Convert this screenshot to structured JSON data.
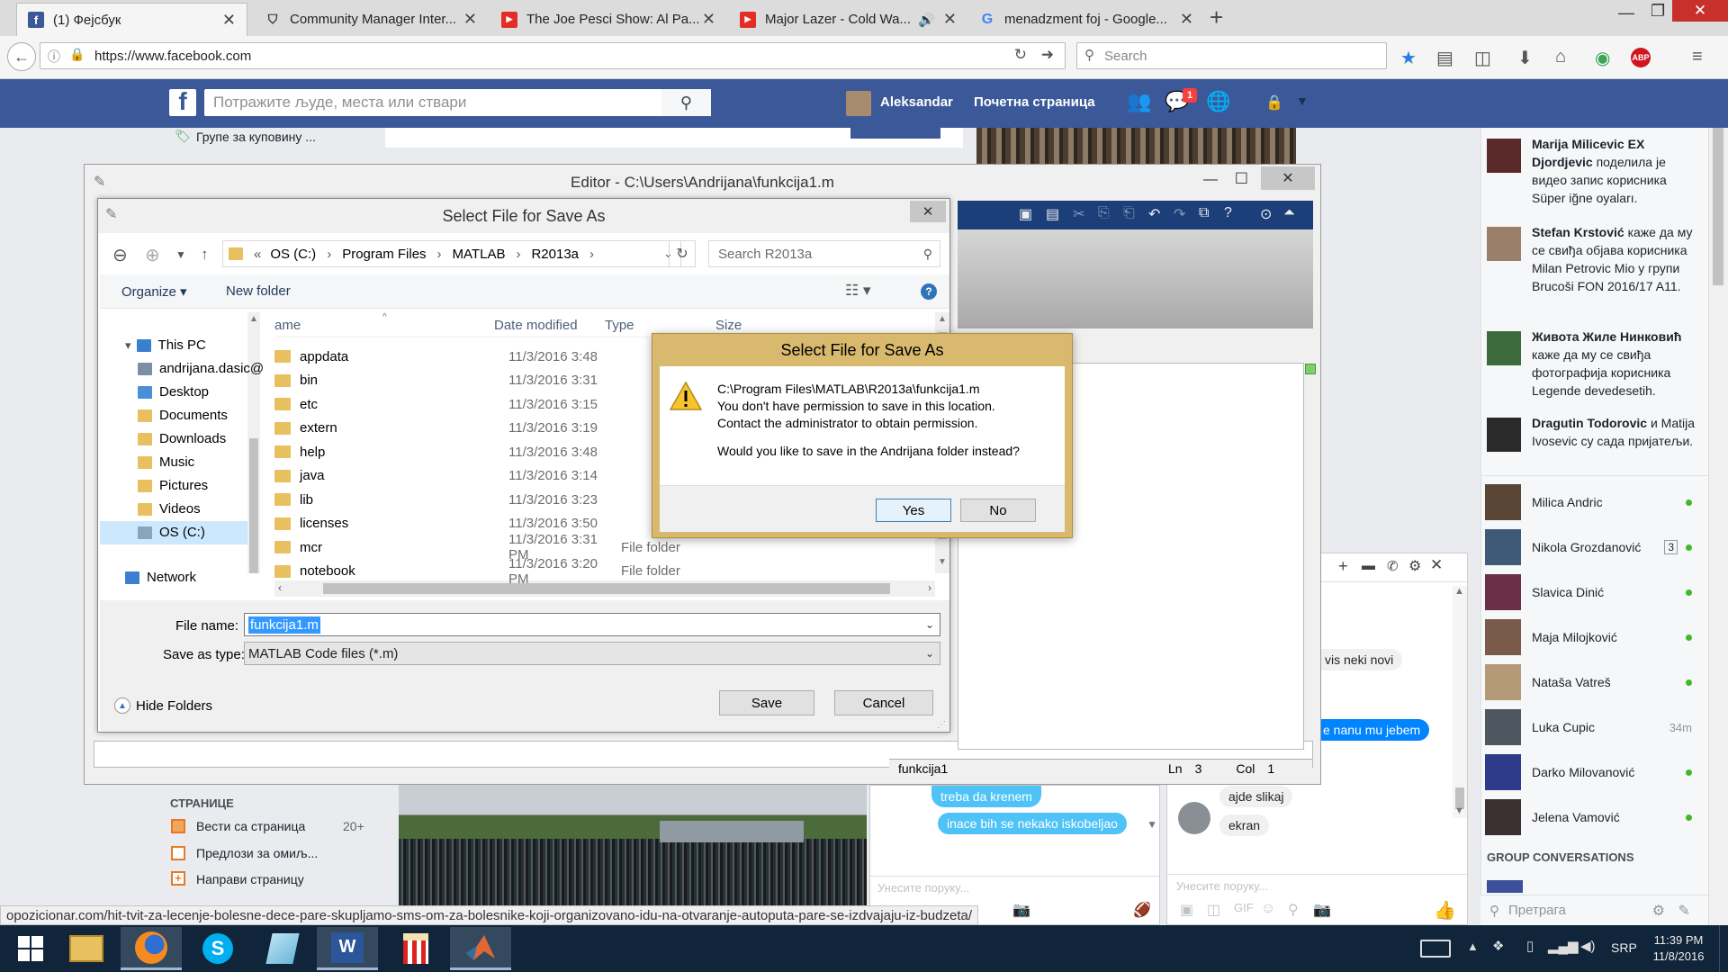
{
  "browser": {
    "tabs": [
      {
        "title": "(1) Фејсбук",
        "icon": "facebook-icon",
        "active": true
      },
      {
        "title": "Community Manager Inter...",
        "icon": "shield-icon"
      },
      {
        "title": "The Joe Pesci Show: Al Pa...",
        "icon": "youtube-icon"
      },
      {
        "title": "Major Lazer - Cold Wa...",
        "icon": "youtube-icon"
      },
      {
        "title": "menadzment foj - Google...",
        "icon": "google-icon"
      }
    ],
    "new_tab": "+",
    "url": "https://www.facebook.com",
    "search_placeholder": "Search"
  },
  "facebook": {
    "search_placeholder": "Потражите људе, места или ствари",
    "user_name": "Aleksandar",
    "home_label": "Почетна страница",
    "notification_count": "1",
    "left_top_item": "Групе за куповину ...",
    "pages_header": "СТРАНИЦЕ",
    "pages_items": [
      {
        "label": "Вести са страница",
        "count": "20+"
      },
      {
        "label": "Предлози за омиљ...",
        "count": ""
      },
      {
        "label": "Направи страницу",
        "count": ""
      }
    ],
    "ticker": [
      {
        "bold": "Marija Milicevic EX Djordjevic",
        "text": " поделила је видео запис корисника Süper iğne oyaları."
      },
      {
        "bold": "Stefan Krstović",
        "text": " каже да му се свиђа објава корисника Milan Petrovic Mio у групи Brucoši FON 2016/17 A11."
      },
      {
        "bold": "Живота Жиле Нинковић",
        "text": " каже да му се свиђа фотографија корисника Legende devedesetih."
      },
      {
        "bold": "Dragutin Todorovic",
        "text": " и Matija Ivosevic су сада пријатељи."
      }
    ],
    "contacts": [
      {
        "name": "Milica Andric",
        "meta": "",
        "online": true
      },
      {
        "name": "Nikola Grozdanović",
        "meta": "3",
        "online": true
      },
      {
        "name": "Slavica Dinić",
        "meta": "",
        "online": true
      },
      {
        "name": "Maja Milojković",
        "meta": "",
        "online": true
      },
      {
        "name": "Nataša Vatreš",
        "meta": "",
        "online": true
      },
      {
        "name": "Luka Cupic",
        "meta": "34m",
        "online": false
      },
      {
        "name": "Darko Milovanović",
        "meta": "",
        "online": true
      },
      {
        "name": "Jelena Vamović",
        "meta": "",
        "online": true
      }
    ],
    "group_conversations": "GROUP CONVERSATIONS",
    "chat_search_placeholder": "Претрага",
    "chat1_messages": [
      "treba da krenem",
      "inace bih se nekako iskobeljao"
    ],
    "chat1_placeholder": "Унесите поруку...",
    "chat2_messages_received": [
      "vis neki novi",
      "ajde slikaj",
      "ekran"
    ],
    "chat2_message_sent": "e nanu mu jebem",
    "chat2_placeholder": "Унесите поруку..."
  },
  "matlab_editor": {
    "title": "Editor - C:\\Users\\Andrijana\\funkcija1.m",
    "status_file": "funkcija1",
    "status_ln_label": "Ln",
    "status_ln": "3",
    "status_col_label": "Col",
    "status_col": "1"
  },
  "save_dialog": {
    "title": "Select File for Save As",
    "breadcrumb": [
      "OS (C:)",
      "Program Files",
      "MATLAB",
      "R2013a"
    ],
    "breadcrumb_prefix": "«",
    "search_placeholder": "Search R2013a",
    "organize_label": "Organize",
    "new_folder_label": "New folder",
    "columns": {
      "name": "ame",
      "date": "Date modified",
      "type": "Type",
      "size": "Size"
    },
    "tree": [
      {
        "label": "This PC",
        "level": 0
      },
      {
        "label": "andrijana.dasic@",
        "level": 1
      },
      {
        "label": "Desktop",
        "level": 1
      },
      {
        "label": "Documents",
        "level": 1
      },
      {
        "label": "Downloads",
        "level": 1
      },
      {
        "label": "Music",
        "level": 1
      },
      {
        "label": "Pictures",
        "level": 1
      },
      {
        "label": "Videos",
        "level": 1
      },
      {
        "label": "OS (C:)",
        "level": 1
      },
      {
        "label": "Network",
        "level": 0
      }
    ],
    "files": [
      {
        "name": "appdata",
        "date": "11/3/2016 3:48",
        "type": ""
      },
      {
        "name": "bin",
        "date": "11/3/2016 3:31",
        "type": ""
      },
      {
        "name": "etc",
        "date": "11/3/2016 3:15",
        "type": ""
      },
      {
        "name": "extern",
        "date": "11/3/2016 3:19",
        "type": ""
      },
      {
        "name": "help",
        "date": "11/3/2016 3:48",
        "type": ""
      },
      {
        "name": "java",
        "date": "11/3/2016 3:14",
        "type": ""
      },
      {
        "name": "lib",
        "date": "11/3/2016 3:23",
        "type": ""
      },
      {
        "name": "licenses",
        "date": "11/3/2016 3:50",
        "type": ""
      },
      {
        "name": "mcr",
        "date": "11/3/2016 3:31 PM",
        "type": "File folder"
      },
      {
        "name": "notebook",
        "date": "11/3/2016 3:20 PM",
        "type": "File folder"
      }
    ],
    "file_name_label": "File name:",
    "file_name_value": "funkcija1.m",
    "save_type_label": "Save as type:",
    "save_type_value": "MATLAB Code files (*.m)",
    "hide_folders": "Hide Folders",
    "save_button": "Save",
    "cancel_button": "Cancel"
  },
  "message_box": {
    "title": "Select File for Save As",
    "line1": "C:\\Program Files\\MATLAB\\R2013a\\funkcija1.m",
    "line2": "You don't have permission to save in this location.",
    "line3": "Contact the administrator to obtain permission.",
    "line4": "Would you like to save in the Andrijana folder instead?",
    "yes": "Yes",
    "no": "No"
  },
  "status_url": "opozicionar.com/hit-tvit-za-lecenje-bolesne-dece-pare-skupljamo-sms-om-za-bolesnike-koji-organizovano-idu-na-otvaranje-autoputa-pare-se-izdvajaju-iz-budzeta/",
  "taskbar": {
    "lang": "SRP",
    "time": "11:39 PM",
    "date": "11/8/2016"
  },
  "colors": {
    "facebook_blue": "#3b5998",
    "messenger_blue": "#0084ff",
    "taskbar": "#10243a",
    "dialog_gold": "#d9b96d"
  }
}
